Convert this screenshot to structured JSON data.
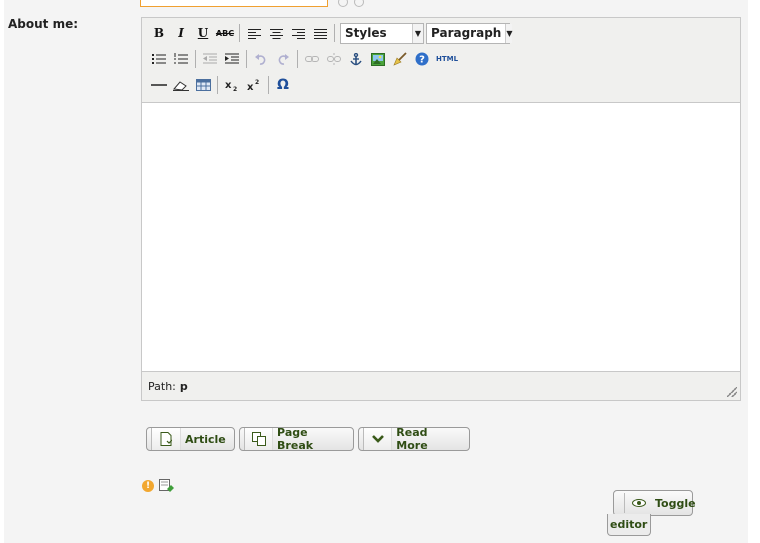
{
  "form": {
    "about_label": "About me:"
  },
  "toolbar": {
    "row1": {
      "bold": "B",
      "italic": "I",
      "underline": "U",
      "strike": "ABC",
      "styles": "Styles",
      "format": "Paragraph"
    },
    "row3": {
      "omega": "Ω"
    },
    "html_label": "HTML"
  },
  "status": {
    "path_label": "Path:",
    "path_value": "p"
  },
  "buttons": {
    "article": "Article",
    "page_break": "Page Break",
    "read_more": "Read More",
    "toggle_editor_line1": "Toggle",
    "toggle_editor_line2": "editor"
  }
}
